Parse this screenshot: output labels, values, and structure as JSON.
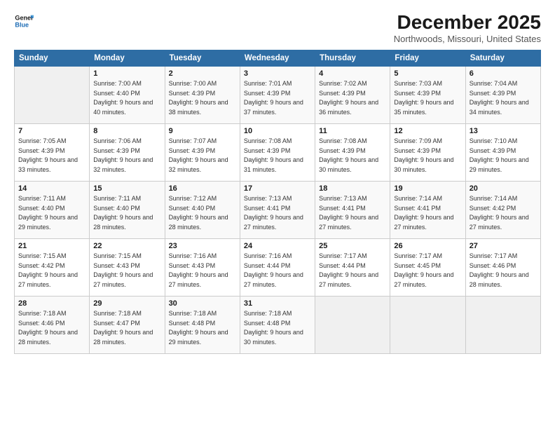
{
  "logo": {
    "general": "General",
    "blue": "Blue"
  },
  "header": {
    "title": "December 2025",
    "location": "Northwoods, Missouri, United States"
  },
  "weekdays": [
    "Sunday",
    "Monday",
    "Tuesday",
    "Wednesday",
    "Thursday",
    "Friday",
    "Saturday"
  ],
  "weeks": [
    [
      {
        "day": "",
        "empty": true
      },
      {
        "day": "1",
        "sunrise": "7:00 AM",
        "sunset": "4:40 PM",
        "daylight": "9 hours and 40 minutes."
      },
      {
        "day": "2",
        "sunrise": "7:00 AM",
        "sunset": "4:39 PM",
        "daylight": "9 hours and 38 minutes."
      },
      {
        "day": "3",
        "sunrise": "7:01 AM",
        "sunset": "4:39 PM",
        "daylight": "9 hours and 37 minutes."
      },
      {
        "day": "4",
        "sunrise": "7:02 AM",
        "sunset": "4:39 PM",
        "daylight": "9 hours and 36 minutes."
      },
      {
        "day": "5",
        "sunrise": "7:03 AM",
        "sunset": "4:39 PM",
        "daylight": "9 hours and 35 minutes."
      },
      {
        "day": "6",
        "sunrise": "7:04 AM",
        "sunset": "4:39 PM",
        "daylight": "9 hours and 34 minutes."
      }
    ],
    [
      {
        "day": "7",
        "sunrise": "7:05 AM",
        "sunset": "4:39 PM",
        "daylight": "9 hours and 33 minutes."
      },
      {
        "day": "8",
        "sunrise": "7:06 AM",
        "sunset": "4:39 PM",
        "daylight": "9 hours and 32 minutes."
      },
      {
        "day": "9",
        "sunrise": "7:07 AM",
        "sunset": "4:39 PM",
        "daylight": "9 hours and 32 minutes."
      },
      {
        "day": "10",
        "sunrise": "7:08 AM",
        "sunset": "4:39 PM",
        "daylight": "9 hours and 31 minutes."
      },
      {
        "day": "11",
        "sunrise": "7:08 AM",
        "sunset": "4:39 PM",
        "daylight": "9 hours and 30 minutes."
      },
      {
        "day": "12",
        "sunrise": "7:09 AM",
        "sunset": "4:39 PM",
        "daylight": "9 hours and 30 minutes."
      },
      {
        "day": "13",
        "sunrise": "7:10 AM",
        "sunset": "4:39 PM",
        "daylight": "9 hours and 29 minutes."
      }
    ],
    [
      {
        "day": "14",
        "sunrise": "7:11 AM",
        "sunset": "4:40 PM",
        "daylight": "9 hours and 29 minutes."
      },
      {
        "day": "15",
        "sunrise": "7:11 AM",
        "sunset": "4:40 PM",
        "daylight": "9 hours and 28 minutes."
      },
      {
        "day": "16",
        "sunrise": "7:12 AM",
        "sunset": "4:40 PM",
        "daylight": "9 hours and 28 minutes."
      },
      {
        "day": "17",
        "sunrise": "7:13 AM",
        "sunset": "4:41 PM",
        "daylight": "9 hours and 27 minutes."
      },
      {
        "day": "18",
        "sunrise": "7:13 AM",
        "sunset": "4:41 PM",
        "daylight": "9 hours and 27 minutes."
      },
      {
        "day": "19",
        "sunrise": "7:14 AM",
        "sunset": "4:41 PM",
        "daylight": "9 hours and 27 minutes."
      },
      {
        "day": "20",
        "sunrise": "7:14 AM",
        "sunset": "4:42 PM",
        "daylight": "9 hours and 27 minutes."
      }
    ],
    [
      {
        "day": "21",
        "sunrise": "7:15 AM",
        "sunset": "4:42 PM",
        "daylight": "9 hours and 27 minutes."
      },
      {
        "day": "22",
        "sunrise": "7:15 AM",
        "sunset": "4:43 PM",
        "daylight": "9 hours and 27 minutes."
      },
      {
        "day": "23",
        "sunrise": "7:16 AM",
        "sunset": "4:43 PM",
        "daylight": "9 hours and 27 minutes."
      },
      {
        "day": "24",
        "sunrise": "7:16 AM",
        "sunset": "4:44 PM",
        "daylight": "9 hours and 27 minutes."
      },
      {
        "day": "25",
        "sunrise": "7:17 AM",
        "sunset": "4:44 PM",
        "daylight": "9 hours and 27 minutes."
      },
      {
        "day": "26",
        "sunrise": "7:17 AM",
        "sunset": "4:45 PM",
        "daylight": "9 hours and 27 minutes."
      },
      {
        "day": "27",
        "sunrise": "7:17 AM",
        "sunset": "4:46 PM",
        "daylight": "9 hours and 28 minutes."
      }
    ],
    [
      {
        "day": "28",
        "sunrise": "7:18 AM",
        "sunset": "4:46 PM",
        "daylight": "9 hours and 28 minutes."
      },
      {
        "day": "29",
        "sunrise": "7:18 AM",
        "sunset": "4:47 PM",
        "daylight": "9 hours and 28 minutes."
      },
      {
        "day": "30",
        "sunrise": "7:18 AM",
        "sunset": "4:48 PM",
        "daylight": "9 hours and 29 minutes."
      },
      {
        "day": "31",
        "sunrise": "7:18 AM",
        "sunset": "4:48 PM",
        "daylight": "9 hours and 30 minutes."
      },
      {
        "day": "",
        "empty": true
      },
      {
        "day": "",
        "empty": true
      },
      {
        "day": "",
        "empty": true
      }
    ]
  ]
}
